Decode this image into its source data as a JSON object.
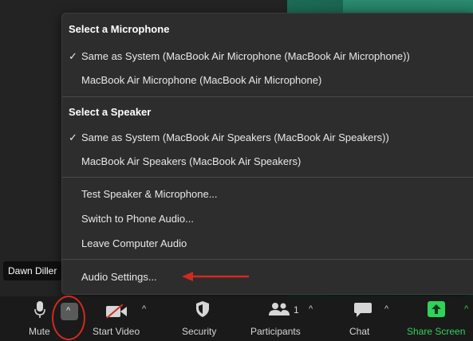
{
  "participant": {
    "name": "Dawn Diller"
  },
  "menu": {
    "microphone_header": "Select a Microphone",
    "microphone_options": [
      {
        "label": "Same as System (MacBook Air Microphone (MacBook Air Microphone))",
        "checked": true
      },
      {
        "label": "MacBook Air Microphone (MacBook Air Microphone)",
        "checked": false
      }
    ],
    "speaker_header": "Select a Speaker",
    "speaker_options": [
      {
        "label": "Same as System (MacBook Air Speakers (MacBook Air Speakers))",
        "checked": true
      },
      {
        "label": "MacBook Air Speakers (MacBook Air Speakers)",
        "checked": false
      }
    ],
    "actions": [
      "Test Speaker & Microphone...",
      "Switch to Phone Audio...",
      "Leave Computer Audio"
    ],
    "settings": "Audio Settings...",
    "check_glyph": "✓"
  },
  "toolbar": {
    "mute": "Mute",
    "start_video": "Start Video",
    "security": "Security",
    "participants": "Participants",
    "participants_count": "1",
    "chat": "Chat",
    "share_screen": "Share Screen",
    "caret_glyph": "^"
  },
  "colors": {
    "menu_bg": "#2d2d2d",
    "annotation_red": "#d22a1e",
    "share_green": "#2fd25a"
  }
}
